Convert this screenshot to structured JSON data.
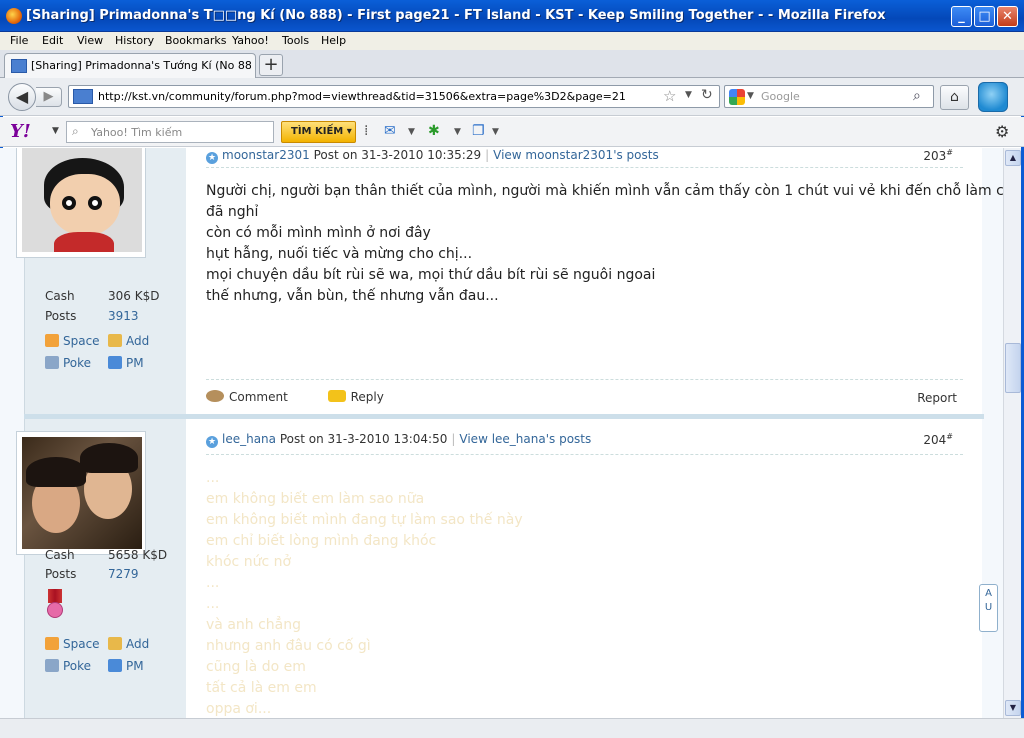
{
  "window": {
    "title": "[Sharing] Primadonna's T□□ng Kí (No 888) - First page21 - FT Island - KST - Keep Smiling Together - - Mozilla Firefox",
    "controls": [
      "_",
      "□",
      "✕"
    ]
  },
  "menu": [
    "File",
    "Edit",
    "View",
    "History",
    "Bookmarks",
    "Yahoo!",
    "Tools",
    "Help"
  ],
  "tab": {
    "label": "[Sharing] Primadonna's Tướng Kí (No 888) - ...",
    "new_tab": "+"
  },
  "nav": {
    "url": "http://kst.vn/community/forum.php?mod=viewthread&tid=31506&extra=page%3D2&page=21",
    "search_placeholder": "Google"
  },
  "yahoo": {
    "logo": "Y!",
    "search_placeholder": "Yahoo! Tìm kiếm",
    "search_button": "TÌM KIẾM ▾"
  },
  "posts": [
    {
      "username": "moonstar2301",
      "posted": "Post on 31-3-2010 10:35:29",
      "view_link": "View moonstar2301's posts",
      "floor": "203",
      "stats": {
        "cash_label": "Cash",
        "cash": "306 K$D",
        "posts_label": "Posts",
        "posts": "3913"
      },
      "actions": {
        "space": "Space",
        "add": "Add",
        "poke": "Poke",
        "pm": "PM"
      },
      "body": [
        "Người chị, người bạn thân thiết của mình, người mà khiến mình vẫn cảm thấy còn 1 chút vui vẻ khi đến chỗ làm cuối cùng",
        "đã nghỉ",
        "còn có mỗi mình mình ở nơi đây",
        "hụt hẫng, nuối tiếc và mừng cho chị...",
        "mọi chuyện dầu bít rùi sẽ wa, mọi thứ dầu bít rùi sẽ nguôi ngoai",
        "thế nhưng, vẫn bùn, thế nhưng vẫn đau..."
      ],
      "comment": "Comment",
      "reply": "Reply",
      "report": "Report"
    },
    {
      "username": "lee_hana",
      "posted": "Post on 31-3-2010 13:04:50",
      "view_link": "View lee_hana's posts",
      "floor": "204",
      "stats": {
        "cash_label": "Cash",
        "cash": "5658 K$D",
        "posts_label": "Posts",
        "posts": "7279"
      },
      "actions": {
        "space": "Space",
        "add": "Add",
        "poke": "Poke",
        "pm": "PM"
      },
      "body": [
        "...",
        "em không biết em làm sao nữa",
        "em không biết mình đang tự làm sao thế này",
        "em chỉ biết lòng mình đang khóc",
        "khóc nức nở",
        "...",
        "...",
        "và anh chẳng",
        "nhưng anh đâu có cố gì",
        "cũng là do em",
        "tất cả là em em",
        "oppa ơi..."
      ]
    }
  ],
  "floor_suffix": "#",
  "float_widget": "A U"
}
